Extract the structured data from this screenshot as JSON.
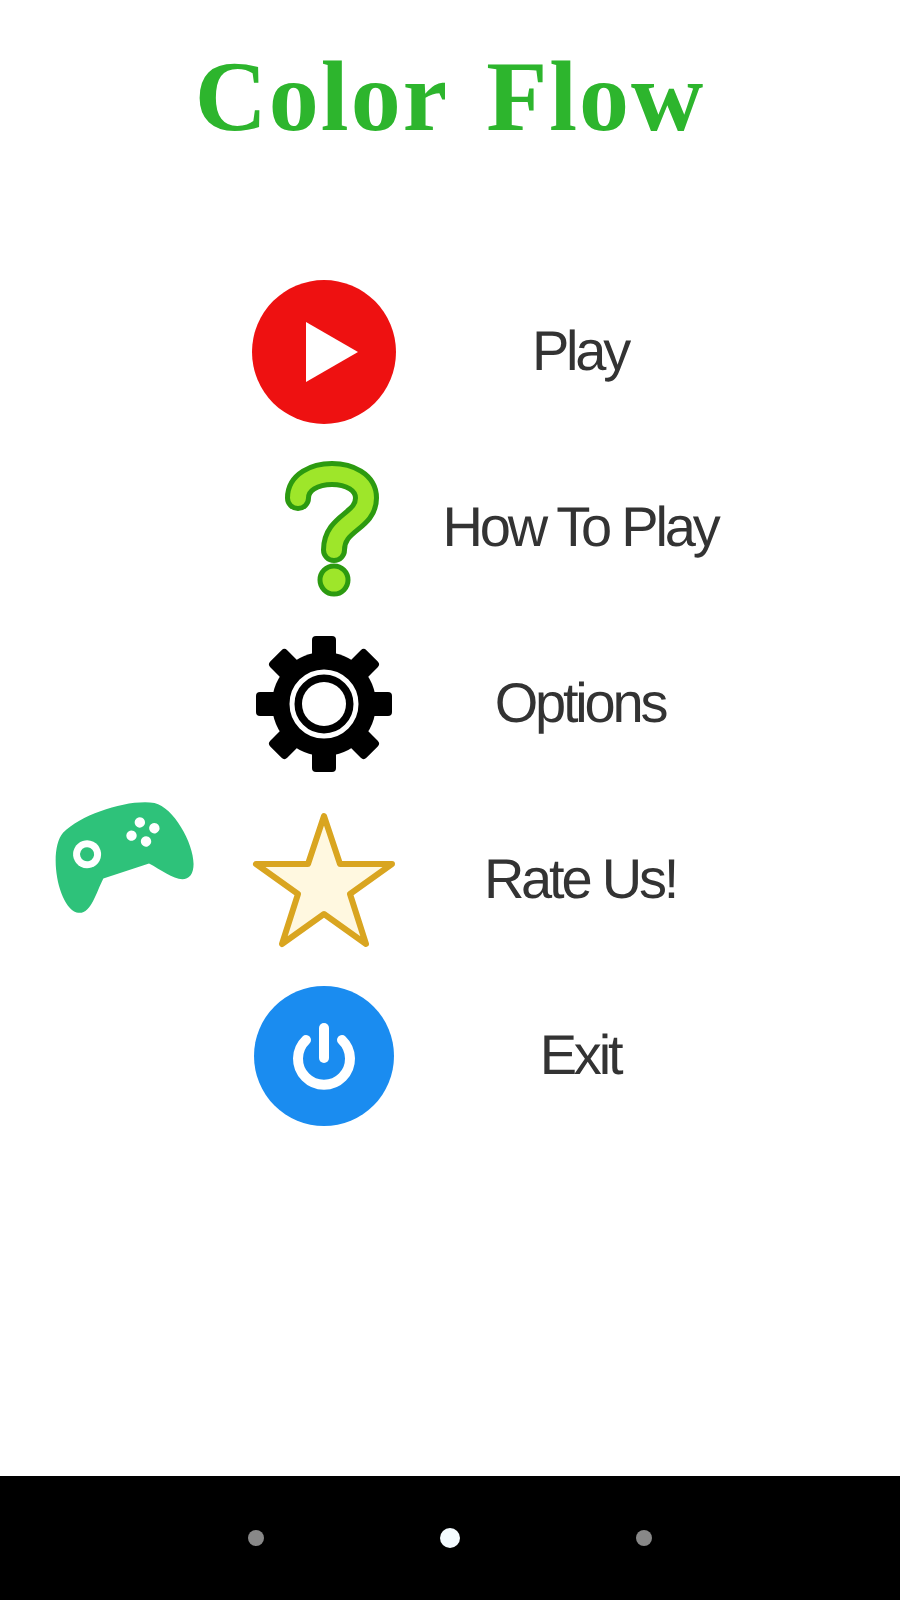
{
  "title": "Color Flow",
  "menu": [
    {
      "kind": "play",
      "label": "Play"
    },
    {
      "kind": "help",
      "label": "How To Play"
    },
    {
      "kind": "options",
      "label": "Options"
    },
    {
      "kind": "rate",
      "label": "Rate Us!"
    },
    {
      "kind": "exit",
      "label": "Exit"
    }
  ]
}
